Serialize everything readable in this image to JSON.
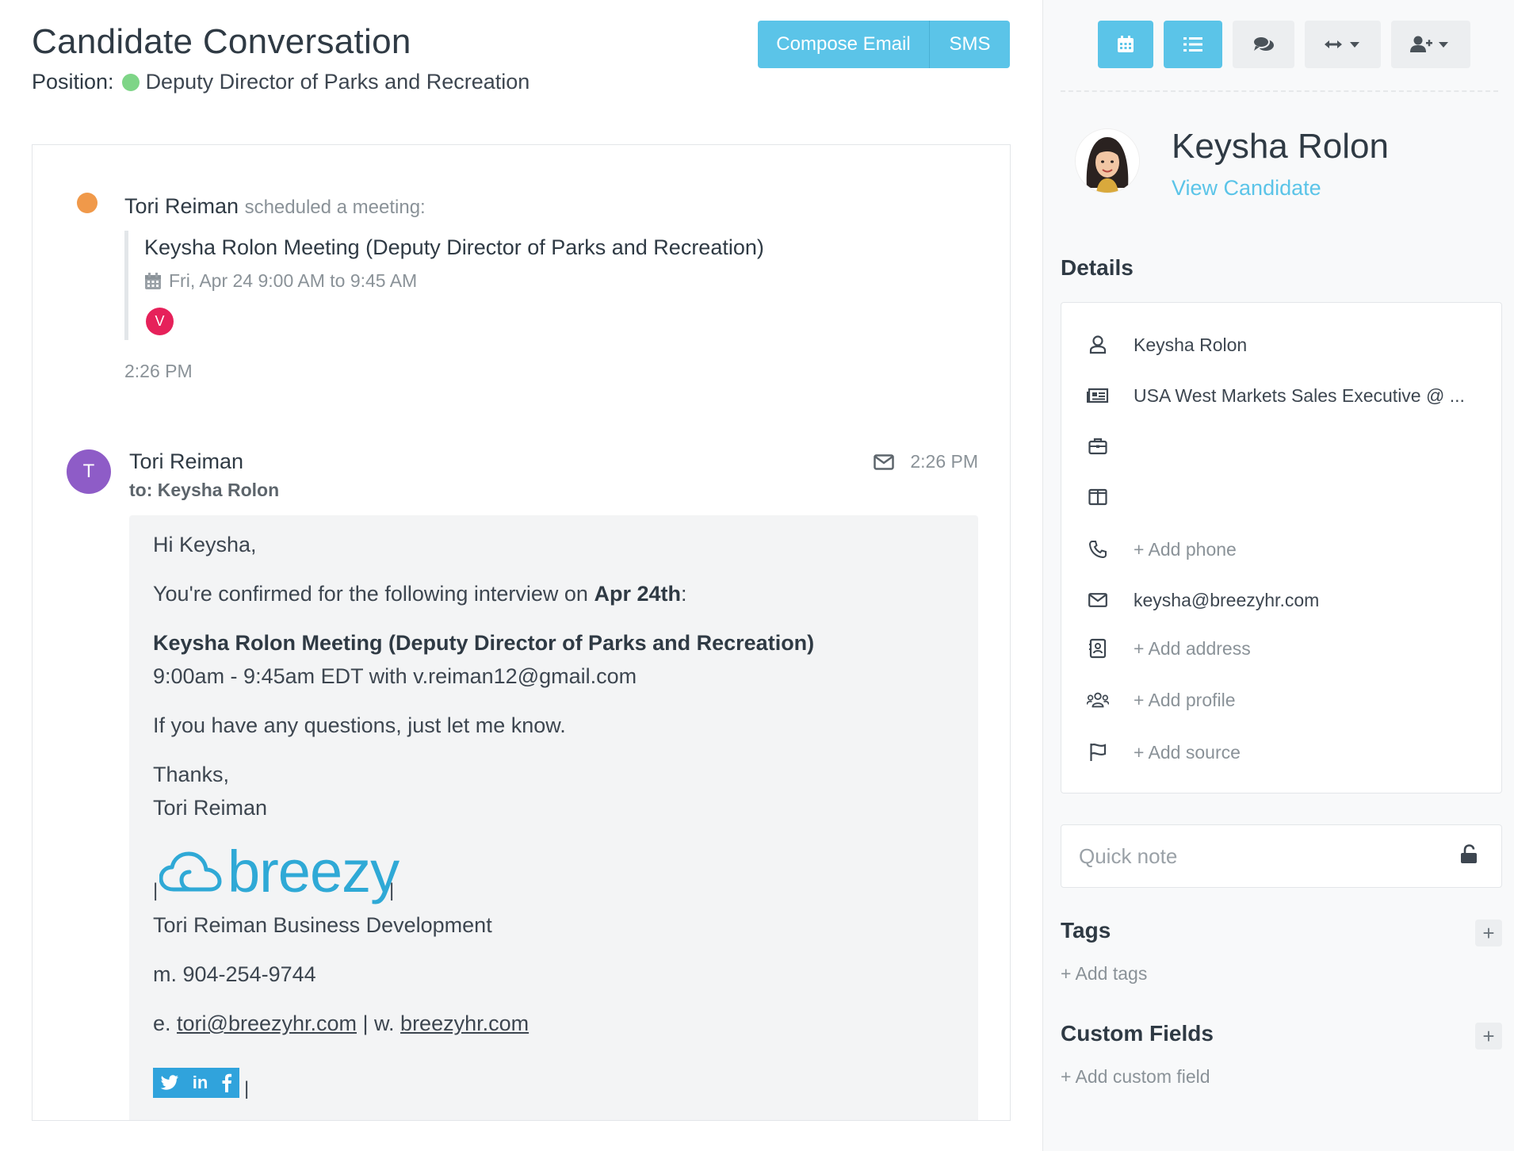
{
  "header": {
    "title": "Candidate Conversation",
    "position_label": "Position:",
    "position_value": "Deputy Director of Parks and Recreation",
    "compose_label": "Compose Email",
    "sms_label": "SMS"
  },
  "activity": {
    "actor": "Tori Reiman",
    "action": "scheduled a meeting:",
    "meeting_title": "Keysha Rolon Meeting (Deputy Director of Parks and Recreation)",
    "meeting_time": "Fri, Apr 24 9:00 AM to 9:45 AM",
    "attendee_initial": "V",
    "timestamp": "2:26 PM"
  },
  "email": {
    "avatar_initial": "T",
    "from": "Tori Reiman",
    "to": "to: Keysha Rolon",
    "time": "2:26 PM",
    "greeting": "Hi Keysha,",
    "confirm_prefix": "You're confirmed for the following interview on ",
    "confirm_date": "Apr 24th",
    "confirm_suffix": ":",
    "meeting_title": "Keysha Rolon Meeting (Deputy Director of Parks and Recreation)",
    "meeting_detail": "9:00am - 9:45am EDT with v.reiman12@gmail.com",
    "questions": "If you have any questions, just let me know.",
    "thanks": "Thanks,",
    "signature_name": "Tori Reiman",
    "logo_text": "breezy",
    "pipe": "|",
    "signature_title": "Tori Reiman Business Development",
    "mobile": "m. 904-254-9744",
    "email_prefix": "e. ",
    "email_link": "tori@breezyhr.com",
    "web_sep": " | w. ",
    "web_link": "breezyhr.com",
    "social_linkedin": "in"
  },
  "toolbar": {
    "icons": [
      "calendar-icon",
      "list-icon",
      "comments-icon",
      "arrows-h-icon",
      "user-plus-icon"
    ]
  },
  "candidate": {
    "name": "Keysha Rolon",
    "view_link": "View Candidate"
  },
  "details": {
    "title": "Details",
    "name": "Keysha Rolon",
    "headline": "USA West Markets Sales Executive @ ...",
    "company": "",
    "education": "",
    "phone_add": "+ Add phone",
    "email": "keysha@breezyhr.com",
    "address_add": "+ Add address",
    "profile_add": "+ Add profile",
    "source_add": "+ Add source"
  },
  "quick_note": {
    "placeholder": "Quick note"
  },
  "tags": {
    "title": "Tags",
    "add": "+ Add tags",
    "plus": "+"
  },
  "custom_fields": {
    "title": "Custom Fields",
    "add": "+ Add custom field",
    "plus": "+"
  },
  "colors": {
    "accent": "#5bc4e8",
    "green_dot": "#7ed587",
    "orange_dot": "#f0994a",
    "attendee_badge": "#e6215a",
    "sender_avatar": "#8e5cc7",
    "breezy_blue": "#2fa9d6"
  }
}
